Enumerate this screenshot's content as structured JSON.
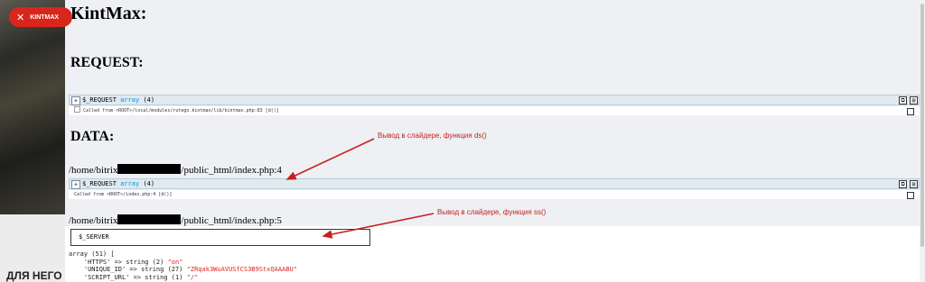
{
  "kint_button": {
    "label": "KINTMAX",
    "close_glyph": "✕"
  },
  "background": {
    "left_text": "ДЛЯ НЕГО"
  },
  "main": {
    "title": "KintMax:",
    "request_heading": "REQUEST:",
    "data_heading": "DATA:"
  },
  "request_dump": {
    "var_name": "$_REQUEST",
    "type": "array",
    "count": "(4)",
    "called_from": "Called from <ROOT>/local/modules/rutego.kintmax/lib/kintmax.php:83 [d()]"
  },
  "data_dump": {
    "path_prefix": "/home/bitrix",
    "path_suffix_1": "/public_html/index.php:4",
    "var_name": "$_REQUEST",
    "type": "array",
    "count": "(4)",
    "called_from": "Called from <ROOT>/index.php:4 [d()]",
    "path_suffix_2": "/public_html/index.php:5"
  },
  "server_dump": {
    "box_label": "$_SERVER",
    "array_line": "array (51) [",
    "rows": [
      {
        "key": "'HTTPS' => string (2) ",
        "val": "\"on\""
      },
      {
        "key": "'UNIQUE_ID' => string (27) ",
        "val": "\"ZRqak3WuAVUSfCS3B9StxQAAABU\""
      },
      {
        "key": "'SCRIPT_URL' => string (1) ",
        "val": "\"/\""
      }
    ]
  },
  "annotations": {
    "ds": "Вывод в слайдере, функция ds()",
    "ss": "Вывод в слайдере, функция ss()"
  },
  "colors": {
    "accent_red": "#c82020",
    "kint_red": "#d9261c",
    "type_blue": "#0092db"
  }
}
